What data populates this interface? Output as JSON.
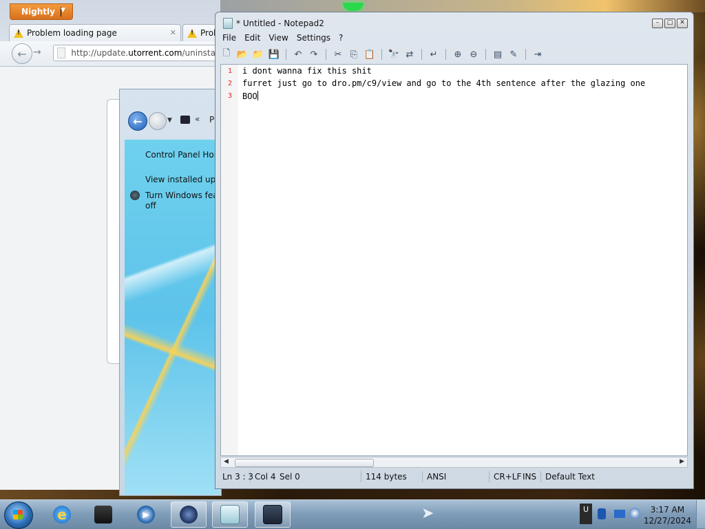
{
  "browser": {
    "menu_button": "Nightly",
    "tabs": [
      {
        "label": "Problem loading page"
      },
      {
        "label": "Probl"
      }
    ],
    "url_prefix": "http://update.",
    "url_domain": "utorrent.com",
    "url_suffix": "/uninstall?"
  },
  "control_panel": {
    "breadcrumb_sep": "«",
    "breadcrumb_text": "P",
    "links": [
      {
        "label": "Control Panel Hom"
      },
      {
        "label": "View installed upda"
      },
      {
        "label": "Turn Windows feat"
      },
      {
        "label": "off"
      }
    ]
  },
  "notepad": {
    "title": "* Untitled - Notepad2",
    "menu": [
      "File",
      "Edit",
      "View",
      "Settings",
      "?"
    ],
    "lines": [
      {
        "num": "1",
        "text": "i dont wanna fix this shit"
      },
      {
        "num": "2",
        "text": "furret just go to dro.pm/c9/view and go to the 4th sentence after the glazing one"
      },
      {
        "num": "3",
        "text": "BOO"
      }
    ],
    "status": {
      "position": "Ln 3 : 3",
      "col": "Col 4",
      "sel": "Sel 0",
      "size": "114 bytes",
      "encoding": "ANSI",
      "eol": "CR+LF",
      "mode": "INS",
      "scheme": "Default Text"
    }
  },
  "taskbar": {
    "time": "3:17 AM",
    "date": "12/27/2024",
    "tray_label": "U"
  }
}
